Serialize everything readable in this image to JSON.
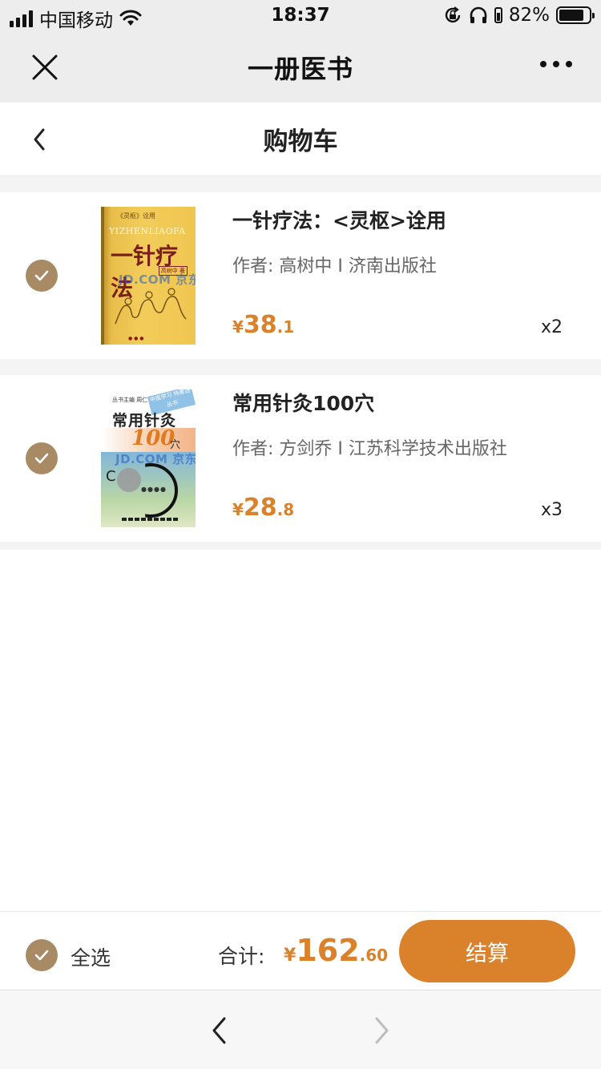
{
  "status_bar": {
    "carrier": "中国移动",
    "time": "18:37",
    "battery_percent": "82%",
    "battery_level": 0.82,
    "icons": [
      "signal-icon",
      "wifi-icon",
      "rotation-lock-icon",
      "headphones-icon",
      "battery-icon"
    ]
  },
  "mini_program": {
    "title": "一册医书",
    "close_icon": "close-icon",
    "more_icon": "more-icon"
  },
  "nav": {
    "title": "购物车",
    "back_icon": "chevron-left-icon"
  },
  "cart": {
    "items": [
      {
        "title": "一针疗法：<灵枢>诠用",
        "author": "作者: 高树中 I 济南出版社",
        "price_symbol": "¥",
        "price_int": "38",
        "price_dec": ".1",
        "quantity": "x2",
        "checked": true,
        "cover": {
          "series": "《灵枢》诠用",
          "pinyin": "YIZHENLIAOFA",
          "title": "一针疗法",
          "author_tag": "高树中 著",
          "watermark": "JD.COM 京东"
        }
      },
      {
        "title": "常用针灸100穴",
        "author": "作者: 方剑乔 I 江苏科学技术出版社",
        "price_symbol": "¥",
        "price_int": "28",
        "price_dec": ".8",
        "quantity": "x3",
        "checked": true,
        "cover": {
          "series": "丛书主编  周仁 方",
          "ribbon": "中医学习 特惠选丛书",
          "title": "常用针灸",
          "number": "100",
          "unit": "穴",
          "letter": "C",
          "watermark": "JD.COM 京东"
        }
      }
    ]
  },
  "checkout": {
    "select_all_label": "全选",
    "select_all_checked": true,
    "total_label": "合计:",
    "total_symbol": "¥",
    "total_int": "162",
    "total_dec": ".60",
    "button_label": "结算"
  },
  "browser_nav": {
    "back_icon": "chevron-left-icon",
    "forward_icon": "chevron-right-icon",
    "forward_enabled": false
  },
  "colors": {
    "accent": "#d9822b",
    "check": "#a88b64",
    "bar_bg": "#ededed"
  }
}
